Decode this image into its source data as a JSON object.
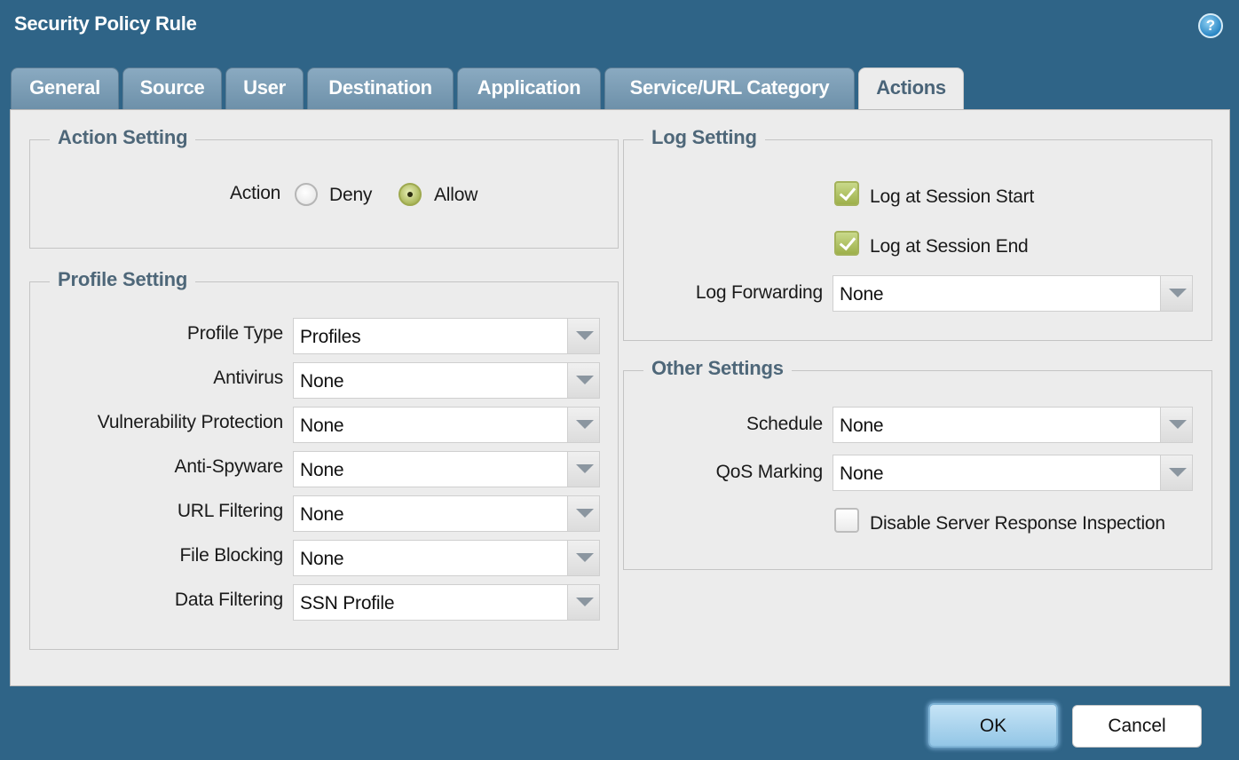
{
  "dialog": {
    "title": "Security Policy Rule",
    "help_icon": "question-mark-icon"
  },
  "tabs": [
    {
      "label": "General",
      "active": false
    },
    {
      "label": "Source",
      "active": false
    },
    {
      "label": "User",
      "active": false
    },
    {
      "label": "Destination",
      "active": false
    },
    {
      "label": "Application",
      "active": false
    },
    {
      "label": "Service/URL Category",
      "active": false
    },
    {
      "label": "Actions",
      "active": true
    }
  ],
  "action_setting": {
    "legend": "Action Setting",
    "action_label": "Action",
    "options": [
      {
        "label": "Deny",
        "selected": false
      },
      {
        "label": "Allow",
        "selected": true
      }
    ]
  },
  "profile_setting": {
    "legend": "Profile Setting",
    "fields": [
      {
        "label": "Profile Type",
        "value": "Profiles"
      },
      {
        "label": "Antivirus",
        "value": "None"
      },
      {
        "label": "Vulnerability Protection",
        "value": "None"
      },
      {
        "label": "Anti-Spyware",
        "value": "None"
      },
      {
        "label": "URL Filtering",
        "value": "None"
      },
      {
        "label": "File Blocking",
        "value": "None"
      },
      {
        "label": "Data Filtering",
        "value": "SSN Profile"
      }
    ]
  },
  "log_setting": {
    "legend": "Log Setting",
    "log_start": {
      "label": "Log at Session Start",
      "checked": true
    },
    "log_end": {
      "label": "Log at Session End",
      "checked": true
    },
    "log_forwarding": {
      "label": "Log Forwarding",
      "value": "None"
    }
  },
  "other_settings": {
    "legend": "Other Settings",
    "schedule": {
      "label": "Schedule",
      "value": "None"
    },
    "qos": {
      "label": "QoS Marking",
      "value": "None"
    },
    "disable_inspection": {
      "label": "Disable Server Response Inspection",
      "checked": false
    }
  },
  "buttons": {
    "ok": "OK",
    "cancel": "Cancel"
  },
  "colors": {
    "title_bar": "#2f6487",
    "tab_inactive": "#7d9db5",
    "panel": "#ececec",
    "legend_text": "#4e6779",
    "checked_green": "#a7b455",
    "ok_button": "#a9d3ee"
  }
}
